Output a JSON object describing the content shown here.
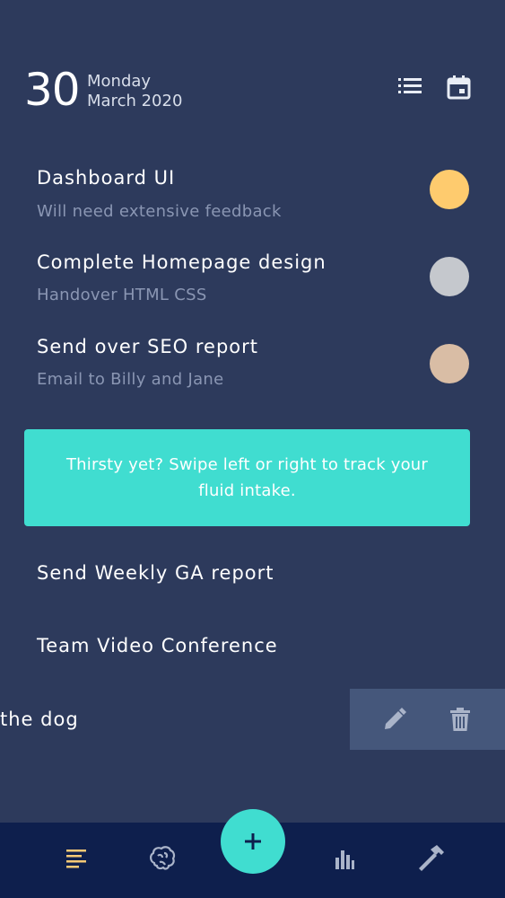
{
  "header": {
    "day": "30",
    "weekday": "Monday",
    "month_year": "March 2020",
    "icons": [
      "list-icon",
      "calendar-icon"
    ]
  },
  "tasks": [
    {
      "title": "Dashboard UI",
      "subtitle": "Will need extensive feedback",
      "dot_color": "#fecb6e"
    },
    {
      "title": "Complete Homepage design",
      "subtitle": "Handover HTML CSS",
      "dot_color": "#c5c8cd"
    },
    {
      "title": "Send over SEO report",
      "subtitle": "Email to Billy and Jane",
      "dot_color": "#d9bda5"
    }
  ],
  "banner": {
    "text": "Thirsty yet? Swipe left or right to track your fluid intake."
  },
  "simple_tasks": [
    {
      "title": "Send Weekly GA report"
    },
    {
      "title": "Team Video Conference"
    },
    {
      "title": "the dog"
    }
  ],
  "swipe_actions": {
    "icons": [
      "pencil-icon",
      "trash-icon"
    ]
  },
  "bottom_nav": {
    "items": [
      "tasks-icon",
      "brain-icon",
      "plus-icon",
      "stats-icon",
      "hammer-icon"
    ],
    "active": "tasks-icon"
  },
  "colors": {
    "background": "#2d3a5c",
    "accent": "#40ddd0",
    "nav_background": "#0e1f4d",
    "active_nav": "#f6c975"
  }
}
